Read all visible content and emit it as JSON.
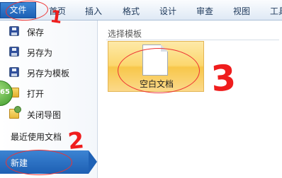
{
  "ribbon": {
    "tabs": [
      {
        "label": "文件"
      },
      {
        "label": "首页"
      },
      {
        "label": "插入"
      },
      {
        "label": "格式"
      },
      {
        "label": "设计"
      },
      {
        "label": "审查"
      },
      {
        "label": "视图"
      },
      {
        "label": "工具"
      }
    ]
  },
  "menu": {
    "items": [
      {
        "label": "保存",
        "icon": "save-icon"
      },
      {
        "label": "另存为",
        "icon": "save-as-icon"
      },
      {
        "label": "另存为模板",
        "icon": "save-as-template-icon"
      },
      {
        "label": "打开",
        "icon": "open-folder-icon"
      },
      {
        "label": "关闭导图",
        "icon": "close-map-icon"
      },
      {
        "label": "最近使用文档"
      },
      {
        "label": "新建"
      }
    ],
    "selected": "新建",
    "accent_color": "#1f62b6"
  },
  "badge": {
    "text": "65"
  },
  "template_pane": {
    "title": "选择模板",
    "templates": [
      {
        "label": "空白文档",
        "icon": "blank-document-icon"
      }
    ]
  },
  "annotations": {
    "step1": "1",
    "step2": "2",
    "step3": "3",
    "color": "#ef1d1d"
  }
}
